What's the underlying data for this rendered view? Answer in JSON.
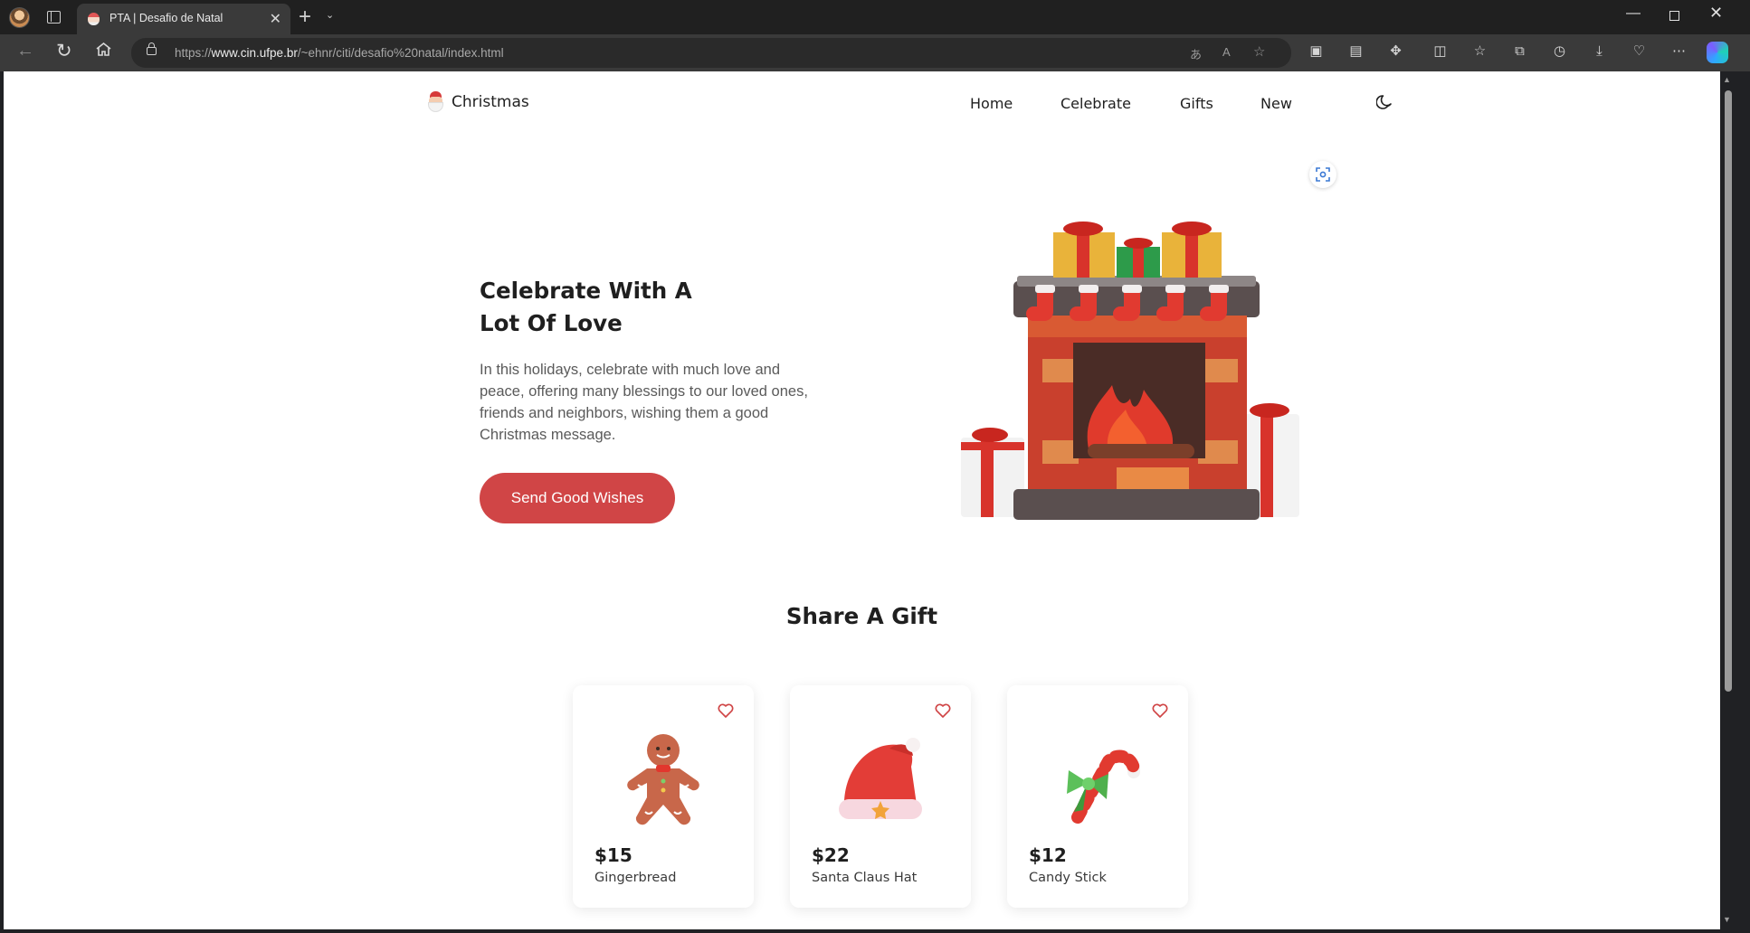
{
  "browser": {
    "tab_title": "PTA | Desafio de Natal",
    "url_prefix": "https://",
    "url_host": "www.cin.ufpe.br",
    "url_path": "/~ehnr/citi/desafio%20natal/index.html"
  },
  "site": {
    "brand": "Christmas",
    "nav": [
      "Home",
      "Celebrate",
      "Gifts",
      "New"
    ],
    "hero": {
      "title_line1": "Celebrate With A",
      "title_line2": "Lot Of Love",
      "text": "In this holidays, celebrate with much love and peace, offering many blessings to our loved ones, friends and neighbors, wishing them a good Christmas message.",
      "button": "Send Good Wishes"
    },
    "gifts_title": "Share A Gift",
    "gifts": [
      {
        "price": "$15",
        "name": "Gingerbread",
        "icon": "gingerbread-icon"
      },
      {
        "price": "$22",
        "name": "Santa Claus Hat",
        "icon": "santa-hat-icon"
      },
      {
        "price": "$12",
        "name": "Candy Stick",
        "icon": "candy-cane-icon"
      }
    ]
  },
  "colors": {
    "accent": "#d04546",
    "chrome_dark": "#202020",
    "chrome_mid": "#3a3a3a"
  }
}
